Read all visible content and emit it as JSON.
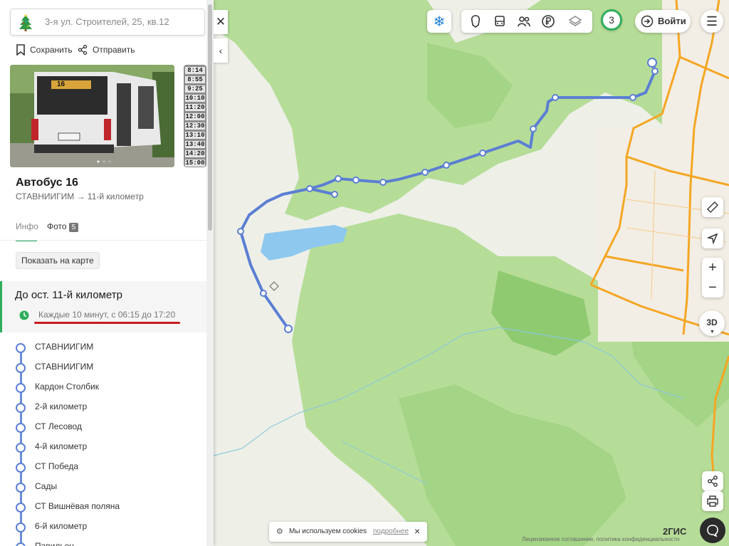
{
  "search": {
    "placeholder": "3-я ул. Строителей, 25, кв.12"
  },
  "actions": {
    "save": "Сохранить",
    "share": "Отправить"
  },
  "photo": {
    "bus_number": "16",
    "side_schedule": [
      "8:14",
      "8:55",
      "9:25",
      "10:10",
      "11:20",
      "12:00",
      "12:30",
      "13:10",
      "13:40",
      "14:20",
      "15:00"
    ]
  },
  "route": {
    "title": "Автобус 16",
    "subtitle": "СТАВНИИГИМ → 11-й километр"
  },
  "tabs": {
    "info": "Инфо",
    "photo": "Фото",
    "photo_count": "5"
  },
  "show_on_map": "Показать на карте",
  "direction": {
    "title": "До ост. 11-й километр",
    "frequency": "Каждые 10 минут, с 06:15 до 17:20"
  },
  "stops": [
    "СТАВНИИГИМ",
    "СТАВНИИГИМ",
    "Кардон Столбик",
    "2-й километр",
    "СТ Лесовод",
    "4-й километр",
    "СТ Победа",
    "Сады",
    "СТ Вишнёвая поляна",
    "6-й километр",
    "Павильон"
  ],
  "top_controls": {
    "notifications_count": "3",
    "login": "Войти"
  },
  "map_controls": {
    "zoom_in": "+",
    "zoom_out": "−",
    "mode_3d": "3D"
  },
  "cookie": {
    "text": "Мы используем cookies",
    "link": "подробнее",
    "close": "×"
  },
  "footer": {
    "legal": "Лицензионное соглашение, политика конфиденциальности",
    "logo": "2ГИС"
  },
  "colors": {
    "route": "#5b7fd3",
    "forest": "#a9d98a",
    "road": "#f5a623",
    "accent": "#2fae5d",
    "underline": "#c81d1d"
  }
}
